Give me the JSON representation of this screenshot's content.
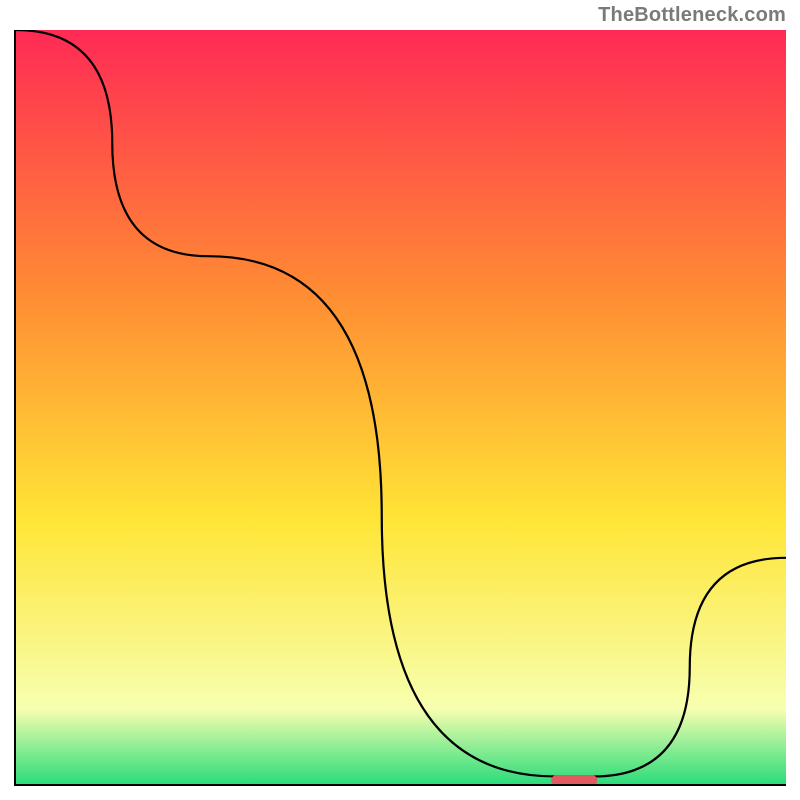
{
  "watermark": "TheBottleneck.com",
  "chart_data": {
    "type": "line",
    "title": "",
    "xlabel": "",
    "ylabel": "",
    "xlim": [
      0,
      100
    ],
    "ylim": [
      0,
      100
    ],
    "gradient_background": {
      "top": "#ff2a55",
      "mid_upper": "#ff8c33",
      "mid": "#ffe536",
      "lower": "#f7ffb0",
      "bottom": "#2bdc7a"
    },
    "series": [
      {
        "name": "bottleneck-curve",
        "x": [
          0,
          25,
          70,
          75,
          100
        ],
        "values": [
          100,
          70,
          1,
          1,
          30
        ]
      }
    ],
    "marker": {
      "name": "optimal-range",
      "x_center": 72.5,
      "y": 0.5,
      "width": 6,
      "color": "#e05a62"
    }
  }
}
